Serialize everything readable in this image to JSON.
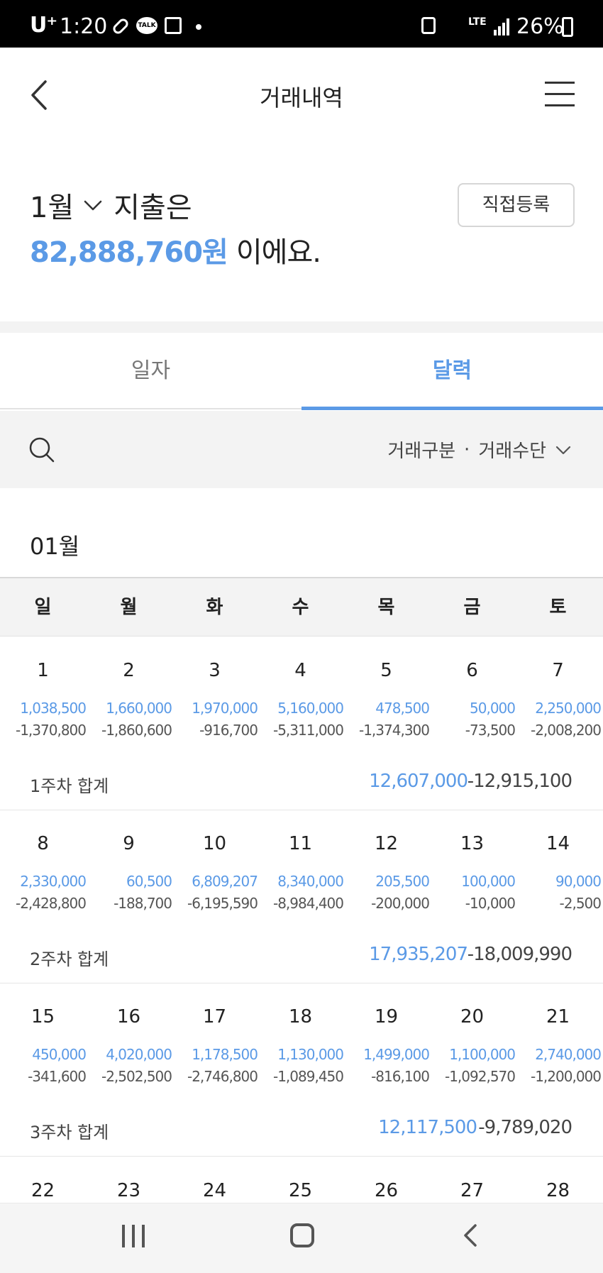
{
  "status_bar": {
    "carrier": "U⁺",
    "time": "1:20",
    "network": "LTE",
    "battery": "26%"
  },
  "header": {
    "title": "거래내역"
  },
  "summary": {
    "month": "1월",
    "expense_label": "지출은",
    "amount": "82,888,760원",
    "suffix": "이에요.",
    "direct_register_button": "직접등록"
  },
  "tabs": [
    {
      "label": "일자",
      "active": false
    },
    {
      "label": "달력",
      "active": true
    }
  ],
  "filter": {
    "type": "거래구분",
    "separator": "·",
    "method": "거래수단"
  },
  "calendar": {
    "month_heading": "01월",
    "weekdays": [
      "일",
      "월",
      "화",
      "수",
      "목",
      "금",
      "토"
    ],
    "weeks": [
      {
        "days": [
          {
            "day": "1",
            "income": "1,038,500",
            "expense": "-1,370,800"
          },
          {
            "day": "2",
            "income": "1,660,000",
            "expense": "-1,860,600"
          },
          {
            "day": "3",
            "income": "1,970,000",
            "expense": "-916,700"
          },
          {
            "day": "4",
            "income": "5,160,000",
            "expense": "-5,311,000"
          },
          {
            "day": "5",
            "income": "478,500",
            "expense": "-1,374,300"
          },
          {
            "day": "6",
            "income": "50,000",
            "expense": "-73,500"
          },
          {
            "day": "7",
            "income": "2,250,000",
            "expense": "-2,008,200"
          }
        ],
        "total_label": "1주차 합계",
        "total_income": "12,607,000",
        "total_expense": "-12,915,100"
      },
      {
        "days": [
          {
            "day": "8",
            "income": "2,330,000",
            "expense": "-2,428,800"
          },
          {
            "day": "9",
            "income": "60,500",
            "expense": "-188,700"
          },
          {
            "day": "10",
            "income": "6,809,207",
            "expense": "-6,195,590"
          },
          {
            "day": "11",
            "income": "8,340,000",
            "expense": "-8,984,400"
          },
          {
            "day": "12",
            "income": "205,500",
            "expense": "-200,000"
          },
          {
            "day": "13",
            "income": "100,000",
            "expense": "-10,000"
          },
          {
            "day": "14",
            "income": "90,000",
            "expense": "-2,500"
          }
        ],
        "total_label": "2주차 합계",
        "total_income": "17,935,207",
        "total_expense": "-18,009,990"
      },
      {
        "days": [
          {
            "day": "15",
            "income": "450,000",
            "expense": "-341,600"
          },
          {
            "day": "16",
            "income": "4,020,000",
            "expense": "-2,502,500"
          },
          {
            "day": "17",
            "income": "1,178,500",
            "expense": "-2,746,800"
          },
          {
            "day": "18",
            "income": "1,130,000",
            "expense": "-1,089,450"
          },
          {
            "day": "19",
            "income": "1,499,000",
            "expense": "-816,100"
          },
          {
            "day": "20",
            "income": "1,100,000",
            "expense": "-1,092,570"
          },
          {
            "day": "21",
            "income": "2,740,000",
            "expense": "-1,200,000"
          }
        ],
        "total_label": "3주차 합계",
        "total_income": "12,117,500",
        "total_expense": "-9,789,020"
      }
    ],
    "partial_week_days": [
      "22",
      "23",
      "24",
      "25",
      "26",
      "27",
      "28"
    ]
  },
  "colors": {
    "accent": "#5b9ae6",
    "text": "#222222",
    "muted_band": "#f3f3f3"
  },
  "icons": [
    "back-icon",
    "menu-icon",
    "chevron-down-icon",
    "search-icon",
    "nav-recent-icon",
    "nav-home-icon",
    "nav-back-icon"
  ]
}
